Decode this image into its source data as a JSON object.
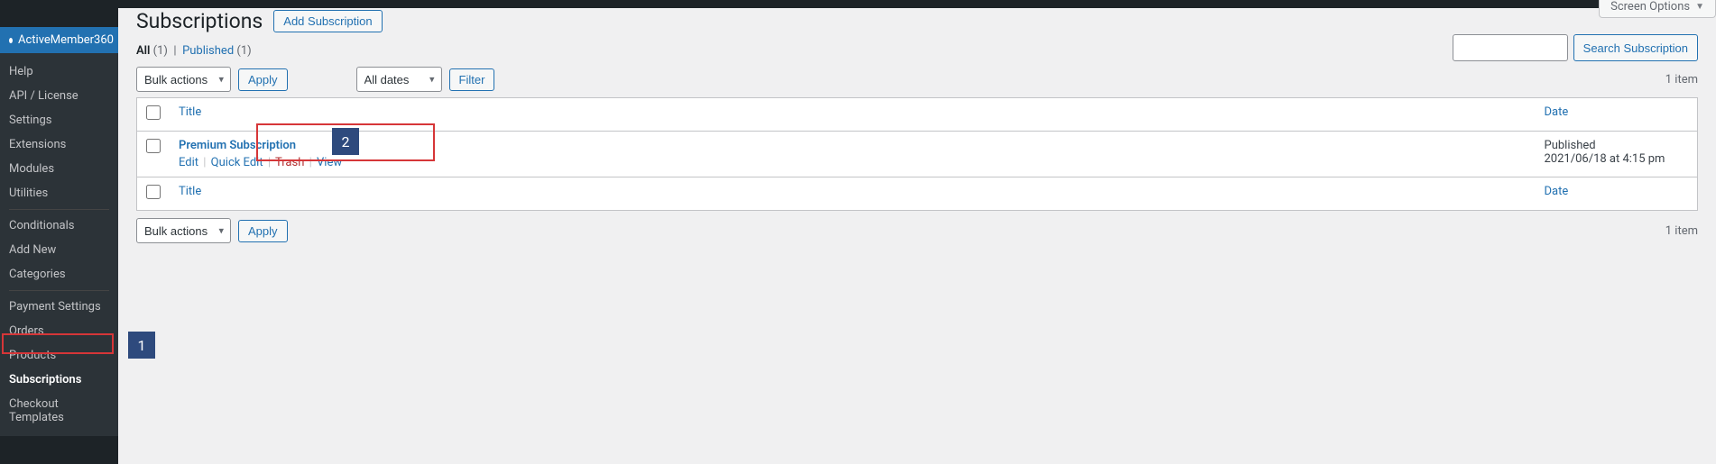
{
  "sidebar": {
    "active_label": "ActiveMember360",
    "items": [
      {
        "label": "Help"
      },
      {
        "label": "API / License"
      },
      {
        "label": "Settings"
      },
      {
        "label": "Extensions"
      },
      {
        "label": "Modules"
      },
      {
        "label": "Utilities"
      }
    ],
    "group2": [
      {
        "label": "Conditionals"
      },
      {
        "label": "Add New"
      },
      {
        "label": "Categories"
      }
    ],
    "group3": [
      {
        "label": "Payment Settings"
      },
      {
        "label": "Orders"
      },
      {
        "label": "Products"
      },
      {
        "label": "Subscriptions",
        "current": true
      },
      {
        "label": "Checkout Templates"
      }
    ]
  },
  "header": {
    "page_title": "Subscriptions",
    "add_button": "Add Subscription",
    "screen_options": "Screen Options"
  },
  "filters": {
    "all_label": "All",
    "all_count": "(1)",
    "published_label": "Published",
    "published_count": "(1)"
  },
  "toolbar": {
    "bulk_label": "Bulk actions",
    "apply_label": "Apply",
    "dates_label": "All dates",
    "filter_label": "Filter",
    "items_count": "1 item"
  },
  "search": {
    "button": "Search Subscription"
  },
  "table": {
    "col_title": "Title",
    "col_date": "Date",
    "rows": [
      {
        "title": "Premium Subscription",
        "actions": {
          "edit": "Edit",
          "quick": "Quick Edit",
          "trash": "Trash",
          "view": "View"
        },
        "status": "Published",
        "time": "2021/06/18 at 4:15 pm"
      }
    ]
  },
  "callouts": {
    "one": "1",
    "two": "2"
  }
}
